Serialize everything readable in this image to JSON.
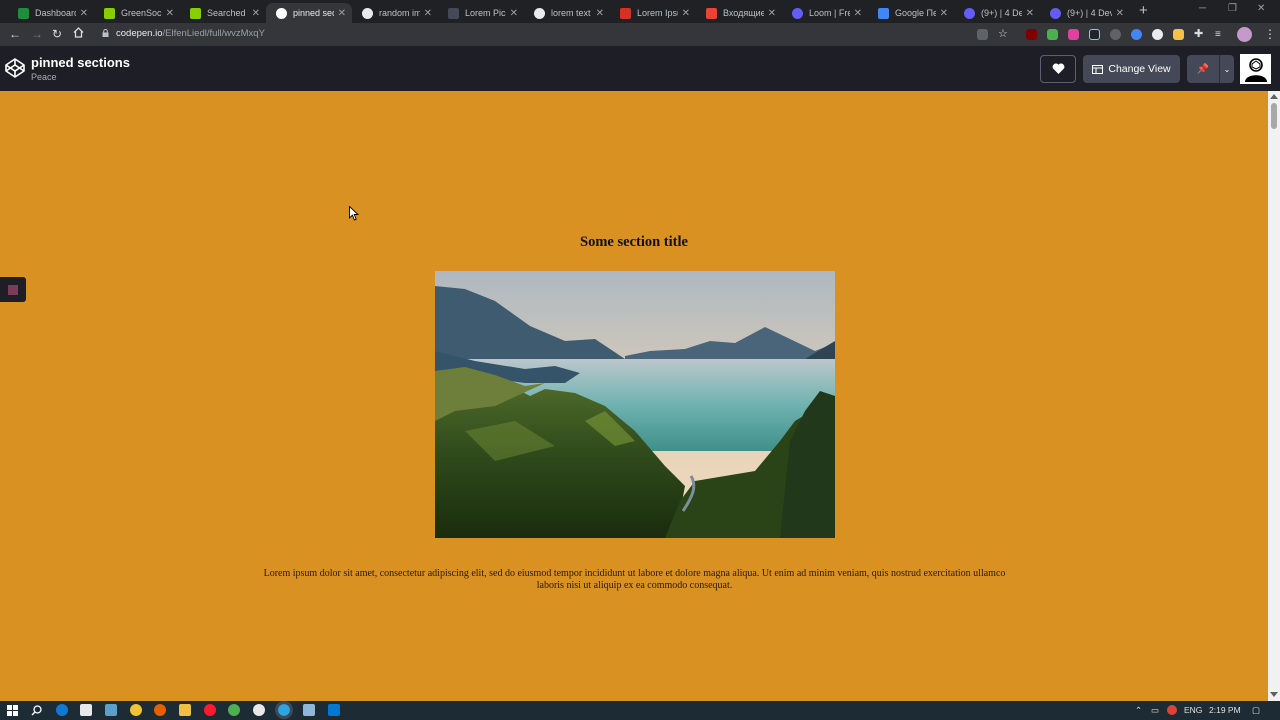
{
  "browser": {
    "tabs": [
      {
        "label": "Dashboard",
        "icon": "sheets-icon",
        "color": "#1e8e3e"
      },
      {
        "label": "GreenSock",
        "icon": "greensock-icon",
        "color": "#88ce02"
      },
      {
        "label": "Searched",
        "icon": "greensock-icon",
        "color": "#88ce02"
      },
      {
        "label": "pinned sections",
        "icon": "codepen-icon",
        "color": "#ffffff"
      },
      {
        "label": "random image",
        "icon": "google-icon",
        "color": "#e8eaed"
      },
      {
        "label": "Lorem Picsum",
        "icon": "picsum-icon",
        "color": "#444857"
      },
      {
        "label": "lorem text",
        "icon": "google-icon",
        "color": "#e8eaed"
      },
      {
        "label": "Lorem Ipsum",
        "icon": "lipsum-icon",
        "color": "#d93025"
      },
      {
        "label": "Входящие",
        "icon": "gmail-icon",
        "color": "#ea4335"
      },
      {
        "label": "Loom | Free",
        "icon": "loom-icon",
        "color": "#625df5"
      },
      {
        "label": "Google Переводчик",
        "icon": "translate-icon",
        "color": "#4285f4"
      },
      {
        "label": "(9+) | 4 Dev",
        "icon": "loom-icon",
        "color": "#625df5"
      },
      {
        "label": "(9+) | 4 Dev",
        "icon": "loom-icon",
        "color": "#625df5"
      }
    ],
    "active_tab_index": 3,
    "url_host": "codepen.io",
    "url_path": "/ElfenLiedl/full/wvzMxqY"
  },
  "codepen": {
    "pen_title": "pinned sections",
    "pen_author": "Peace",
    "change_view_label": "Change View"
  },
  "page": {
    "section_title": "Some section title",
    "body_text": "Lorem ipsum dolor sit amet, consectetur adipiscing elit, sed do eiusmod tempor incididunt ut labore et dolore magna aliqua. Ut enim ad minim veniam, quis nostrud exercitation ullamco laboris nisi ut aliquip ex ea commodo consequat.",
    "background_color": "#d99122",
    "image": "mountain-lake-forest-photo"
  },
  "taskbar": {
    "language": "ENG",
    "time": "2:19 PM"
  }
}
